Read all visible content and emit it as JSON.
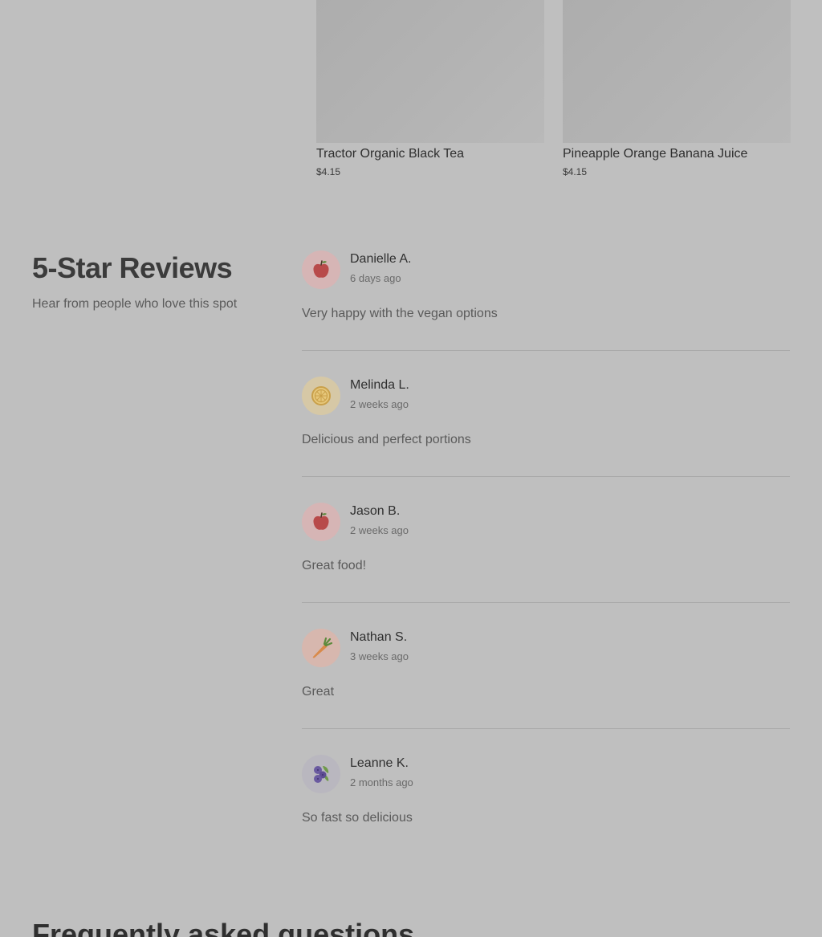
{
  "products": [
    {
      "name": "Tractor Organic Black Tea",
      "price": "$4.15"
    },
    {
      "name": "Pineapple Orange Banana Juice",
      "price": "$4.15"
    }
  ],
  "reviews_section": {
    "title": "5-Star Reviews",
    "subtitle": "Hear from people who love this spot"
  },
  "reviews": [
    {
      "name": "Danielle A.",
      "time": "6 days ago",
      "text": "Very happy with the vegan options",
      "avatar_icon": "apple-icon",
      "avatar_bg": "#d6b5b5"
    },
    {
      "name": "Melinda L.",
      "time": "2 weeks ago",
      "text": "Delicious and perfect portions",
      "avatar_icon": "lemon-icon",
      "avatar_bg": "#d6c8a6"
    },
    {
      "name": "Jason B.",
      "time": "2 weeks ago",
      "text": "Great food!",
      "avatar_icon": "apple-icon",
      "avatar_bg": "#d6b5b5"
    },
    {
      "name": "Nathan S.",
      "time": "3 weeks ago",
      "text": "Great",
      "avatar_icon": "carrot-icon",
      "avatar_bg": "#d7b7ae"
    },
    {
      "name": "Leanne K.",
      "time": "2 months ago",
      "text": "So fast so delicious",
      "avatar_icon": "blueberries-icon",
      "avatar_bg": "#b9b7bf"
    }
  ],
  "faq": {
    "title": "Frequently asked questions"
  }
}
